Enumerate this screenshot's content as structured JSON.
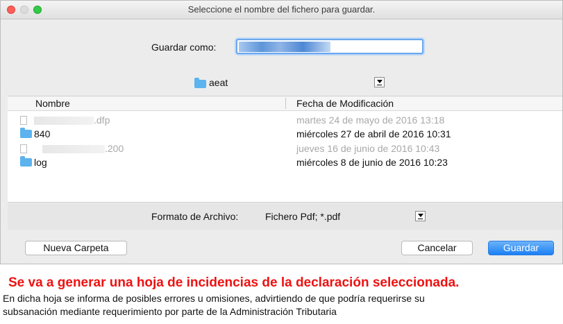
{
  "window": {
    "title": "Seleccione el nombre del fichero para guardar."
  },
  "save_as": {
    "label": "Guardar como:",
    "value": ""
  },
  "location": {
    "folder": "aeat"
  },
  "columns": {
    "name": "Nombre",
    "date": "Fecha de Modificación"
  },
  "files": [
    {
      "name": ".dfp",
      "date": "martes 24 de mayo de 2016 13:18",
      "type": "file",
      "enabled": false,
      "icon": "document-icon"
    },
    {
      "name": "840",
      "date": "miércoles 27 de abril de 2016 10:31",
      "type": "folder",
      "enabled": true,
      "icon": "folder-icon"
    },
    {
      "name": ".200",
      "date": "jueves 16 de junio de 2016 10:43",
      "type": "file",
      "enabled": false,
      "icon": "document-icon"
    },
    {
      "name": "log",
      "date": "miércoles 8 de junio de 2016 10:23",
      "type": "folder",
      "enabled": true,
      "icon": "folder-icon"
    }
  ],
  "format": {
    "label": "Formato de Archivo:",
    "value": "Fichero Pdf; *.pdf"
  },
  "buttons": {
    "new_folder": "Nueva Carpeta",
    "cancel": "Cancelar",
    "save": "Guardar"
  },
  "notice": {
    "title": "Se va a generar una hoja de incidencias de la declaración seleccionada.",
    "line1": "En dicha hoja se informa de posibles errores u omisiones, advirtiendo de que podría requerirse su",
    "line2": "subsanación mediante requerimiento por parte de la Administración Tributaria"
  },
  "colors": {
    "accent": "#1b7ff4",
    "folder": "#5cb3ee",
    "notice_title": "#ee1111"
  }
}
